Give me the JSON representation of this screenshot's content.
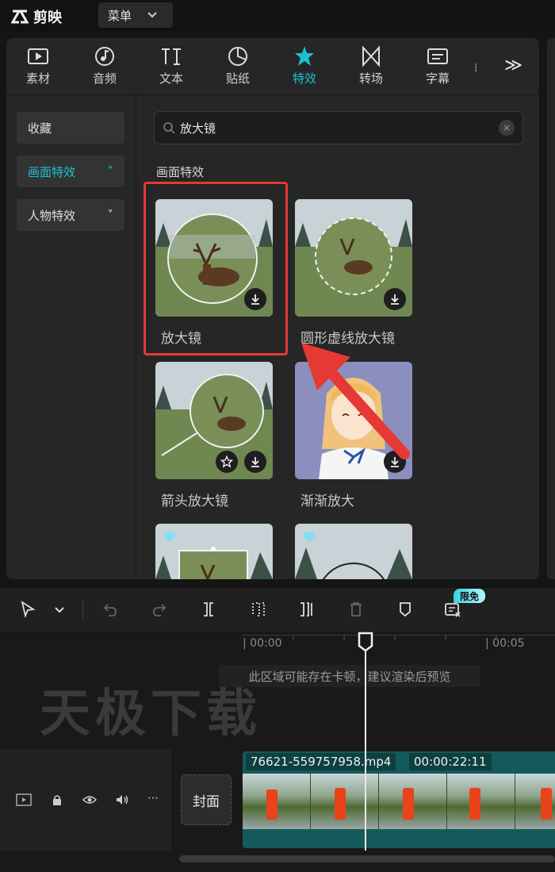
{
  "app": {
    "name": "剪映",
    "menu_label": "菜单"
  },
  "toolbar": {
    "tabs": [
      {
        "label": "素材",
        "icon": "media-icon"
      },
      {
        "label": "音频",
        "icon": "audio-icon"
      },
      {
        "label": "文本",
        "icon": "text-icon"
      },
      {
        "label": "贴纸",
        "icon": "sticker-icon"
      },
      {
        "label": "特效",
        "icon": "effects-icon",
        "active": true
      },
      {
        "label": "转场",
        "icon": "transition-icon"
      },
      {
        "label": "字幕",
        "icon": "caption-icon"
      }
    ],
    "more_symbol": "≫"
  },
  "sidebar": {
    "items": [
      {
        "label": "收藏"
      },
      {
        "label": "画面特效",
        "active": true,
        "chevron": "˅"
      },
      {
        "label": "人物特效",
        "chevron": "˅"
      }
    ]
  },
  "search": {
    "value": "放大镜",
    "clear_symbol": "×"
  },
  "results": {
    "section_title": "画面特效",
    "items": [
      {
        "label": "放大镜"
      },
      {
        "label": "圆形虚线放大镜"
      },
      {
        "label": "箭头放大镜"
      },
      {
        "label": "渐渐放大"
      }
    ]
  },
  "timeline": {
    "badge": "限免",
    "ruler": [
      "| 00:00",
      "| 00:05"
    ],
    "notice": "此区域可能存在卡顿，建议渲染后预览",
    "cover_label": "封面",
    "clip_name": "76621-559757958.mp4",
    "clip_duration": "00:00:22:11",
    "watermark": "天极下载"
  },
  "colors": {
    "accent": "#19c3cf",
    "highlight": "#e53935",
    "clip": "#145a5a"
  }
}
